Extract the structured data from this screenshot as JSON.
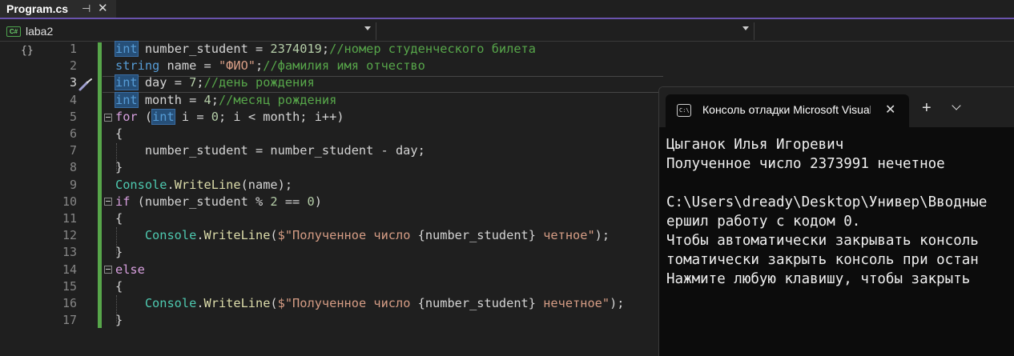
{
  "tab": {
    "title": "Program.cs",
    "pin_icon": "pin-icon",
    "close_icon": "close-icon"
  },
  "navbar": {
    "project": "laba2",
    "member": ""
  },
  "editor": {
    "current_line": 3,
    "lines": [
      {
        "n": "1",
        "code": [
          [
            "hl kw",
            "int"
          ],
          [
            "",
            " number_student = "
          ],
          [
            "num",
            "2374019"
          ],
          [
            "",
            ";"
          ],
          [
            "cmt",
            "//номер студенческого билета"
          ]
        ]
      },
      {
        "n": "2",
        "code": [
          [
            "kw",
            "string"
          ],
          [
            "",
            " name = "
          ],
          [
            "str",
            "\"ФИО\""
          ],
          [
            "",
            ";"
          ],
          [
            "cmt",
            "//фамилия имя отчество"
          ]
        ]
      },
      {
        "n": "3",
        "code": [
          [
            "hl kw",
            "int"
          ],
          [
            "",
            " day = "
          ],
          [
            "num",
            "7"
          ],
          [
            "",
            ";"
          ],
          [
            "cmt",
            "//день рождения"
          ]
        ]
      },
      {
        "n": "4",
        "code": [
          [
            "hl kw",
            "int"
          ],
          [
            "",
            " month = "
          ],
          [
            "num",
            "4"
          ],
          [
            "",
            ";"
          ],
          [
            "cmt",
            "//месяц рождения"
          ]
        ]
      },
      {
        "n": "5",
        "code": [
          [
            "ctl",
            "for"
          ],
          [
            "",
            " ("
          ],
          [
            "hl kw",
            "int"
          ],
          [
            "",
            " i = "
          ],
          [
            "num",
            "0"
          ],
          [
            "",
            "; i < month; i++)"
          ]
        ]
      },
      {
        "n": "6",
        "code": [
          [
            "",
            "{"
          ]
        ]
      },
      {
        "n": "7",
        "code": [
          [
            "",
            "    number_student = number_student - day;"
          ]
        ]
      },
      {
        "n": "8",
        "code": [
          [
            "",
            "}"
          ]
        ]
      },
      {
        "n": "9",
        "code": [
          [
            "typ",
            "Console"
          ],
          [
            "",
            "."
          ],
          [
            "mth",
            "WriteLine"
          ],
          [
            "",
            "(name);"
          ]
        ]
      },
      {
        "n": "10",
        "code": [
          [
            "ctl",
            "if"
          ],
          [
            "",
            " (number_student % "
          ],
          [
            "num",
            "2"
          ],
          [
            "",
            " == "
          ],
          [
            "num",
            "0"
          ],
          [
            "",
            ")"
          ]
        ]
      },
      {
        "n": "11",
        "code": [
          [
            "",
            "{"
          ]
        ]
      },
      {
        "n": "12",
        "code": [
          [
            "",
            "    "
          ],
          [
            "typ",
            "Console"
          ],
          [
            "",
            "."
          ],
          [
            "mth",
            "WriteLine"
          ],
          [
            "",
            "("
          ],
          [
            "str",
            "$\"Полученное число "
          ],
          [
            "",
            "{number_student}"
          ],
          [
            "str",
            " четное\""
          ],
          [
            "",
            ");"
          ]
        ]
      },
      {
        "n": "13",
        "code": [
          [
            "",
            "}"
          ]
        ]
      },
      {
        "n": "14",
        "code": [
          [
            "ctl",
            "else"
          ]
        ]
      },
      {
        "n": "15",
        "code": [
          [
            "",
            "{"
          ]
        ]
      },
      {
        "n": "16",
        "code": [
          [
            "",
            "    "
          ],
          [
            "typ",
            "Console"
          ],
          [
            "",
            "."
          ],
          [
            "mth",
            "WriteLine"
          ],
          [
            "",
            "("
          ],
          [
            "str",
            "$\"Полученное число "
          ],
          [
            "",
            "{number_student}"
          ],
          [
            "str",
            " нечетное\""
          ],
          [
            "",
            ");"
          ]
        ]
      },
      {
        "n": "17",
        "code": [
          [
            "",
            "}"
          ]
        ]
      }
    ]
  },
  "terminal": {
    "tab_title": "Консоль отладки Microsoft Visual Studio",
    "new_tab_label": "+",
    "output": [
      "Цыганок Илья Игоревич",
      "Полученное число 2373991 нечетное",
      "",
      "C:\\Users\\dready\\Desktop\\Универ\\Вводные",
      "ершил работу с кодом 0.",
      "Чтобы автоматически закрывать консоль",
      "томатически закрыть консоль при остан",
      "Нажмите любую клавишу, чтобы закрыть"
    ]
  }
}
